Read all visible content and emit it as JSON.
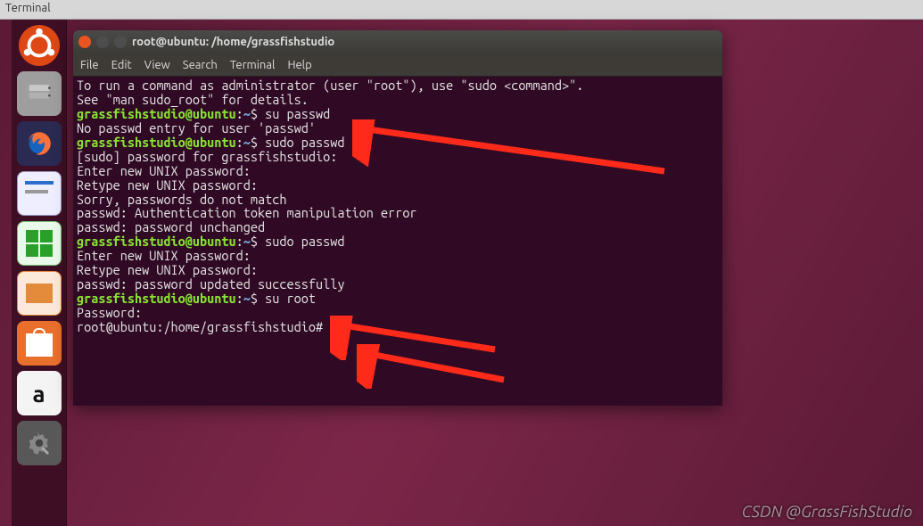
{
  "top_label": "Terminal",
  "launcher": {
    "items": [
      {
        "name": "dash",
        "label": "Ubuntu Dash"
      },
      {
        "name": "files",
        "label": "Files"
      },
      {
        "name": "firefox",
        "label": "Firefox"
      },
      {
        "name": "writer",
        "label": "LibreOffice Writer"
      },
      {
        "name": "calc",
        "label": "LibreOffice Calc"
      },
      {
        "name": "impress",
        "label": "LibreOffice Impress"
      },
      {
        "name": "software",
        "label": "Ubuntu Software"
      },
      {
        "name": "amazon",
        "label": "Amazon"
      },
      {
        "name": "settings",
        "label": "System Settings"
      }
    ]
  },
  "terminal": {
    "title": "root@ubuntu: /home/grassfishstudio",
    "menu": {
      "file": "File",
      "edit": "Edit",
      "view": "View",
      "search": "Search",
      "terminal": "Terminal",
      "help": "Help"
    },
    "prompt": {
      "user": "grassfishstudio@ubuntu",
      "sep": ":",
      "path": "~",
      "sigil": "$"
    },
    "root_prompt": "root@ubuntu:/home/grassfishstudio#",
    "lines": {
      "l0": "To run a command as administrator (user \"root\"), use \"sudo <command>\".",
      "l1": "See \"man sudo_root\" for details.",
      "blank": "",
      "c1": "su passwd",
      "o1": "No passwd entry for user 'passwd'",
      "c2": "sudo passwd",
      "o2": "[sudo] password for grassfishstudio:",
      "o3": "Enter new UNIX password:",
      "o4": "Retype new UNIX password:",
      "o5": "Sorry, passwords do not match",
      "o6": "passwd: Authentication token manipulation error",
      "o7": "passwd: password unchanged",
      "c3": "sudo passwd",
      "o8": "Enter new UNIX password:",
      "o9": "Retype new UNIX password:",
      "o10": "passwd: password updated successfully",
      "c4": "su root",
      "o11": "Password:",
      "root_line": "root@ubuntu:/home/grassfishstudio# "
    }
  },
  "annotation_arrows": {
    "count": 3,
    "color": "#ff2a1a"
  },
  "watermark": "CSDN @GrassFishStudio"
}
